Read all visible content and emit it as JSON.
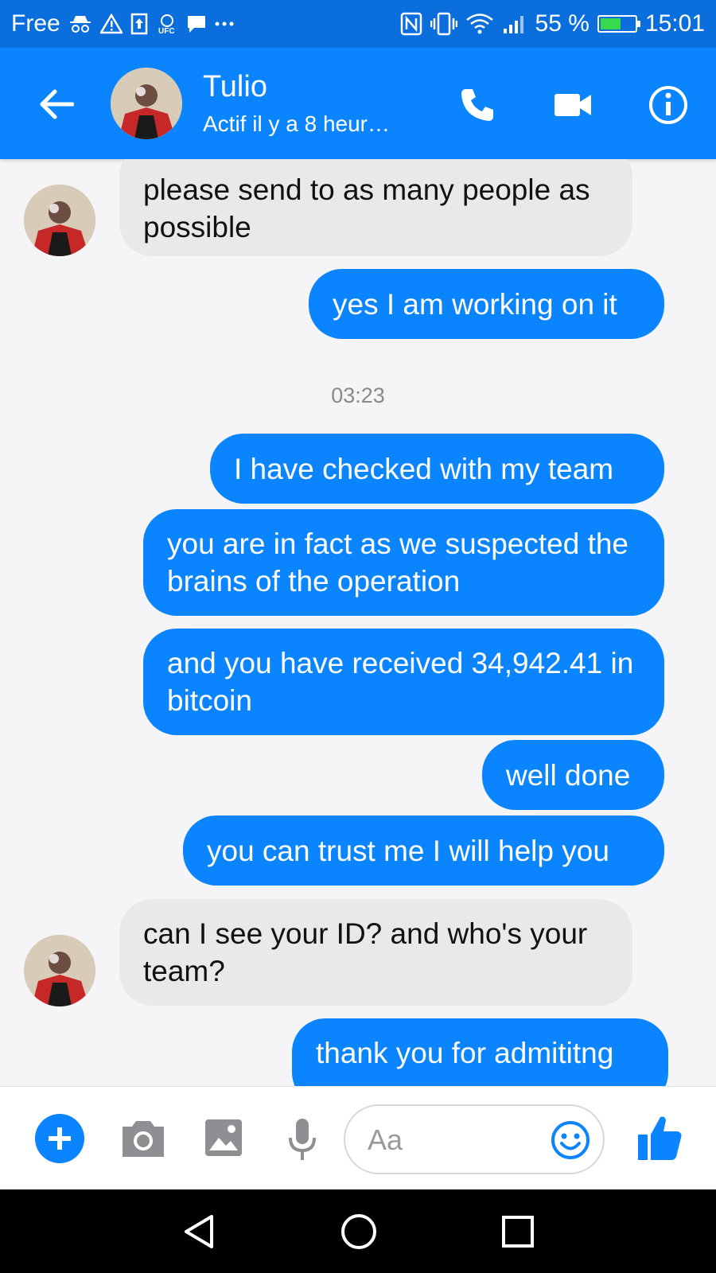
{
  "status_bar": {
    "carrier": "Free",
    "battery_percent": "55 %",
    "battery_level": 0.55,
    "time": "15:01",
    "left_icons": [
      "incognito-icon",
      "warning-icon",
      "upload-icon",
      "ufc-icon",
      "chat-icon",
      "more-icon"
    ],
    "right_icons": [
      "nfc-icon",
      "vibrate-icon",
      "wifi-icon",
      "signal-icon",
      "battery-icon"
    ]
  },
  "header": {
    "name": "Tulio",
    "status": "Actif il y a 8 heur…"
  },
  "messages": {
    "m1": "please send to as many people as possible",
    "m2": "yes I am working on it",
    "timestamp": "03:23",
    "m3": "I have checked with my team",
    "m4": "you are in fact as we suspected the brains of the operation",
    "m5": "and you have received 34,942.41 in bitcoin",
    "m6": "well done",
    "m7": "you can trust me I will help you",
    "m8": "can I see your ID? and who's your team?",
    "m9": "thank you for admititng"
  },
  "composer": {
    "placeholder": "Aa"
  },
  "colors": {
    "status_bar": "#0a6fdc",
    "header": "#0a84ff",
    "outgoing_bubble": "#0a84ff",
    "incoming_bubble": "#e9e9eb"
  }
}
